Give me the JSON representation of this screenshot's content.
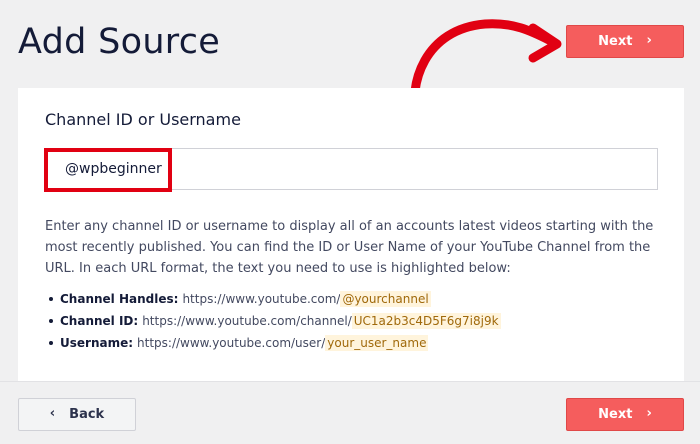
{
  "page": {
    "title": "Add Source"
  },
  "top_next_button": {
    "label": "Next",
    "icon": "chevron-right-icon"
  },
  "source_form": {
    "field_label": "Channel ID or Username",
    "input_value": "@wpbeginner",
    "help_text": "Enter any channel ID or username to display all of an accounts latest videos starting with the most recently published. You can find the ID or User Name of your YouTube Channel from the URL. In each URL format, the text you need to use is highlighted below:",
    "formats": [
      {
        "label": "Channel Handles:",
        "prefix": "https://www.youtube.com/",
        "highlight": "@yourchannel"
      },
      {
        "label": "Channel ID:",
        "prefix": "https://www.youtube.com/channel/",
        "highlight": "UC1a2b3c4D5F6g7i8j9k"
      },
      {
        "label": "Username:",
        "prefix": "https://www.youtube.com/user/",
        "highlight": "your_user_name"
      }
    ]
  },
  "footer": {
    "back_label": "Back",
    "next_label": "Next"
  },
  "colors": {
    "accent": "#f55d5d",
    "annotation_red": "#e10012",
    "highlight_bg": "#fff4dc"
  }
}
